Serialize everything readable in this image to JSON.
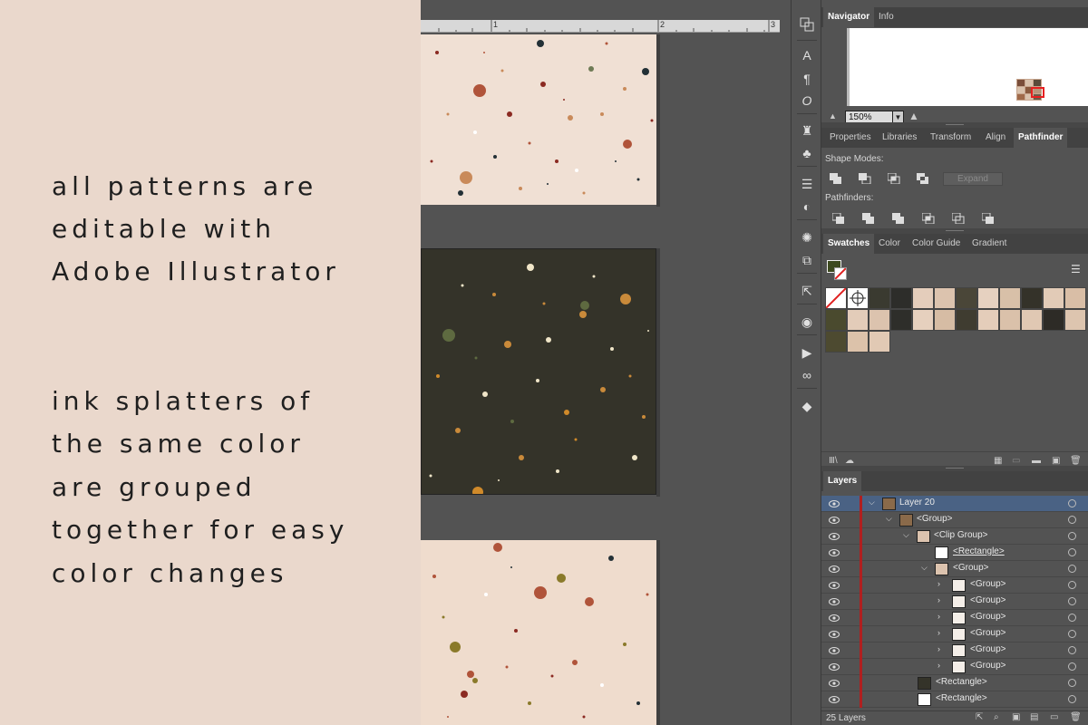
{
  "promo": {
    "lines": [
      "all patterns are",
      "editable with",
      "Adobe Illustrator",
      "ink splatters of",
      "the same color",
      "are grouped",
      "together for easy",
      "color changes"
    ]
  },
  "ruler": {
    "marks": [
      "1",
      "2",
      "3"
    ]
  },
  "navigator_panel": {
    "tabs": [
      "Navigator",
      "Info"
    ],
    "zoom_value": "150%"
  },
  "properties_panel": {
    "tabs": [
      "Properties",
      "Libraries",
      "Transform",
      "Align",
      "Pathfinder"
    ],
    "active_tab": "Pathfinder",
    "shape_modes_label": "Shape Modes:",
    "pathfinders_label": "Pathfinders:",
    "expand_label": "Expand"
  },
  "swatches_panel": {
    "tabs": [
      "Swatches",
      "Color",
      "Color Guide",
      "Gradient"
    ],
    "active_tab": "Swatches",
    "colors": {
      "fill": "#3d4a1f"
    }
  },
  "layers_panel": {
    "tab": "Layers",
    "rows": [
      {
        "name": "Layer 20"
      },
      {
        "name": "<Group>"
      },
      {
        "name": "<Clip Group>"
      },
      {
        "name": "<Rectangle>"
      },
      {
        "name": "<Group>"
      },
      {
        "name": "<Group>"
      },
      {
        "name": "<Group>"
      },
      {
        "name": "<Group>"
      },
      {
        "name": "<Group>"
      },
      {
        "name": "<Group>"
      },
      {
        "name": "<Group>"
      },
      {
        "name": "<Rectangle>"
      },
      {
        "name": "<Rectangle>"
      }
    ],
    "footer_count": "25 Layers"
  },
  "icons": [
    "eye-icon",
    "chevron-right-icon",
    "chevron-down-icon",
    "menu-icon",
    "trash-icon",
    "new-layer-icon"
  ]
}
